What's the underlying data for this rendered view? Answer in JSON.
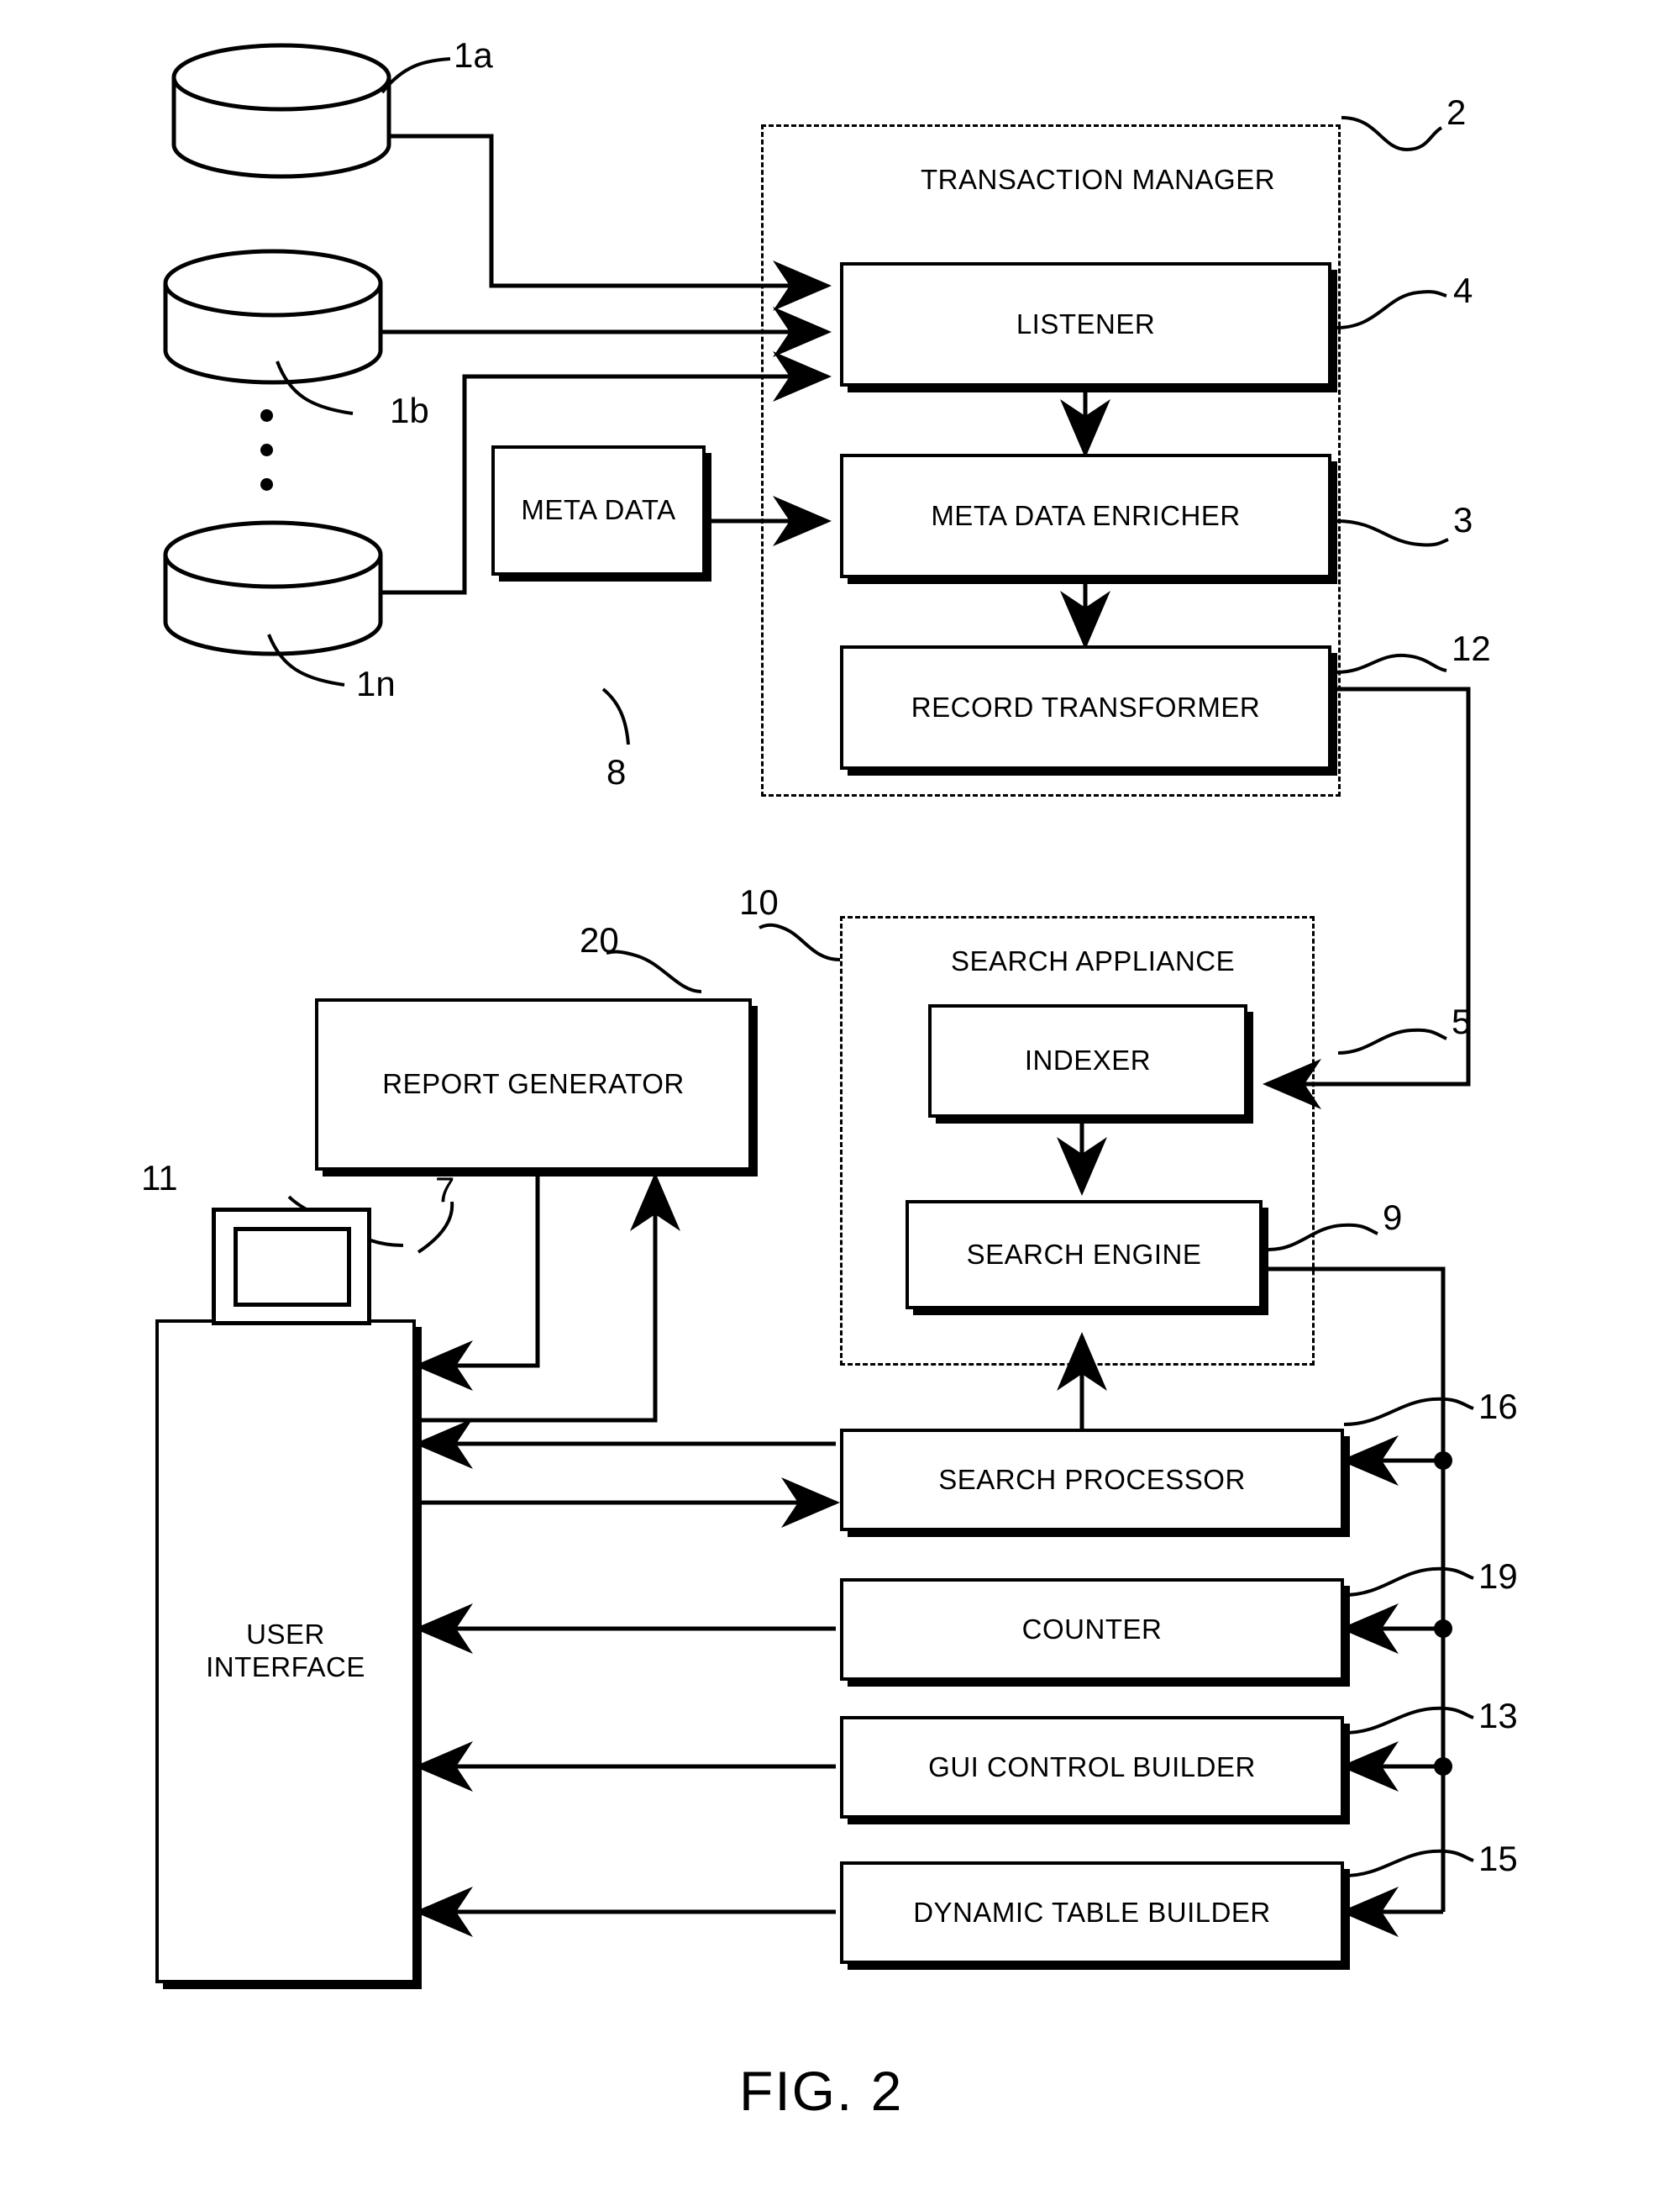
{
  "figure": {
    "caption": "FIG. 2"
  },
  "containers": [
    {
      "id": "transaction-manager",
      "title": "TRANSACTION MANAGER",
      "ref": "2"
    },
    {
      "id": "search-appliance",
      "title": "SEARCH APPLIANCE",
      "ref": "10"
    }
  ],
  "blocks": [
    {
      "id": "listener",
      "label": "LISTENER",
      "ref": "4"
    },
    {
      "id": "meta-data-enricher",
      "label": "META DATA ENRICHER",
      "ref": "3"
    },
    {
      "id": "record-transformer",
      "label": "RECORD TRANSFORMER",
      "ref": "12"
    },
    {
      "id": "meta-data",
      "label": "META DATA",
      "ref": "8"
    },
    {
      "id": "indexer",
      "label": "INDEXER",
      "ref": "5"
    },
    {
      "id": "search-engine",
      "label": "SEARCH ENGINE",
      "ref": "9"
    },
    {
      "id": "report-generator",
      "label": "REPORT GENERATOR",
      "ref": "20"
    },
    {
      "id": "user-interface",
      "label": "USER\nINTERFACE",
      "ref": "7"
    },
    {
      "id": "search-processor",
      "label": "SEARCH PROCESSOR",
      "ref": "16"
    },
    {
      "id": "counter",
      "label": "COUNTER",
      "ref": "19"
    },
    {
      "id": "gui-control-builder",
      "label": "GUI CONTROL BUILDER",
      "ref": "13"
    },
    {
      "id": "dynamic-table-builder",
      "label": "DYNAMIC TABLE BUILDER",
      "ref": "15"
    }
  ],
  "data_sources": [
    {
      "id": "db-1a",
      "ref": "1a"
    },
    {
      "id": "db-1b",
      "ref": "1b"
    },
    {
      "id": "db-1n",
      "ref": "1n"
    }
  ],
  "terminal": {
    "id": "user-terminal",
    "ref": "11"
  },
  "reference_numerals": {
    "transaction_manager": "2",
    "meta_data_enricher": "3",
    "listener": "4",
    "indexer": "5",
    "user_interface": "7",
    "meta_data": "8",
    "search_engine": "9",
    "search_appliance": "10",
    "terminal": "11",
    "record_transformer": "12",
    "gui_control_builder": "13",
    "dynamic_table_builder": "15",
    "search_processor": "16",
    "counter": "19",
    "report_generator": "20",
    "db_a": "1a",
    "db_b": "1b",
    "db_n": "1n"
  }
}
